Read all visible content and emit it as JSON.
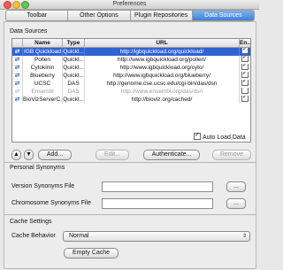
{
  "window": {
    "title": "Preferences"
  },
  "tabs": [
    {
      "label": "Toolbar",
      "active": false
    },
    {
      "label": "Other Options",
      "active": false
    },
    {
      "label": "Plugin Repositories",
      "active": false
    },
    {
      "label": "Data Sources",
      "active": true
    }
  ],
  "data_sources": {
    "section_title": "Data Sources",
    "columns": [
      "",
      "Name",
      "Type",
      "URL",
      "En..."
    ],
    "rows": [
      {
        "name": "IGB Quickload",
        "type": "Quickl...",
        "url": "http://igbquickload.org/quickload/",
        "enabled": true,
        "selected": true,
        "disabled": false
      },
      {
        "name": "Pollen",
        "type": "Quickl...",
        "url": "http://www.igbquickload.org/pollen/",
        "enabled": true,
        "selected": false,
        "disabled": false
      },
      {
        "name": "Cytokinin",
        "type": "Quickl...",
        "url": "http://www.igbquickload.org/cyto/",
        "enabled": true,
        "selected": false,
        "disabled": false
      },
      {
        "name": "Blueberry",
        "type": "Quickl...",
        "url": "http://www.igbquickload.org/blueberry/",
        "enabled": true,
        "selected": false,
        "disabled": false
      },
      {
        "name": "UCSC",
        "type": "DAS",
        "url": "http://genome.cse.ucsc.edu/cgi-bin/das/dsn",
        "enabled": true,
        "selected": false,
        "disabled": false
      },
      {
        "name": "Ensembl",
        "type": "DAS",
        "url": "http://www.ensembl.org/das/dsn",
        "enabled": false,
        "selected": false,
        "disabled": true
      },
      {
        "name": "BioVizServerC...",
        "type": "Quickl...",
        "url": "http://bioviz.org/cached/",
        "enabled": true,
        "selected": false,
        "disabled": false
      }
    ],
    "up_label": "▲",
    "down_label": "▼",
    "add_label": "Add...",
    "edit_label": "Edit...",
    "authenticate_label": "Authenticate...",
    "remove_label": "Remove",
    "auto_load_label": "Auto Load Data",
    "auto_load_checked": true
  },
  "personal_synonyms": {
    "section_title": "Personal Synonyms",
    "version_label": "Version Synonyms File",
    "version_value": "",
    "chromosome_label": "Chromosome Synonyms File",
    "chromosome_value": "",
    "browse_label": "..."
  },
  "cache_settings": {
    "section_title": "Cache Settings",
    "behavior_label": "Cache Behavior",
    "behavior_value": "Normal",
    "empty_cache_label": "Empty Cache"
  },
  "colors": {
    "selection": "#2f62d3",
    "active_tab": "#3f80d6",
    "refresh_icon": "#3a5fb8"
  }
}
